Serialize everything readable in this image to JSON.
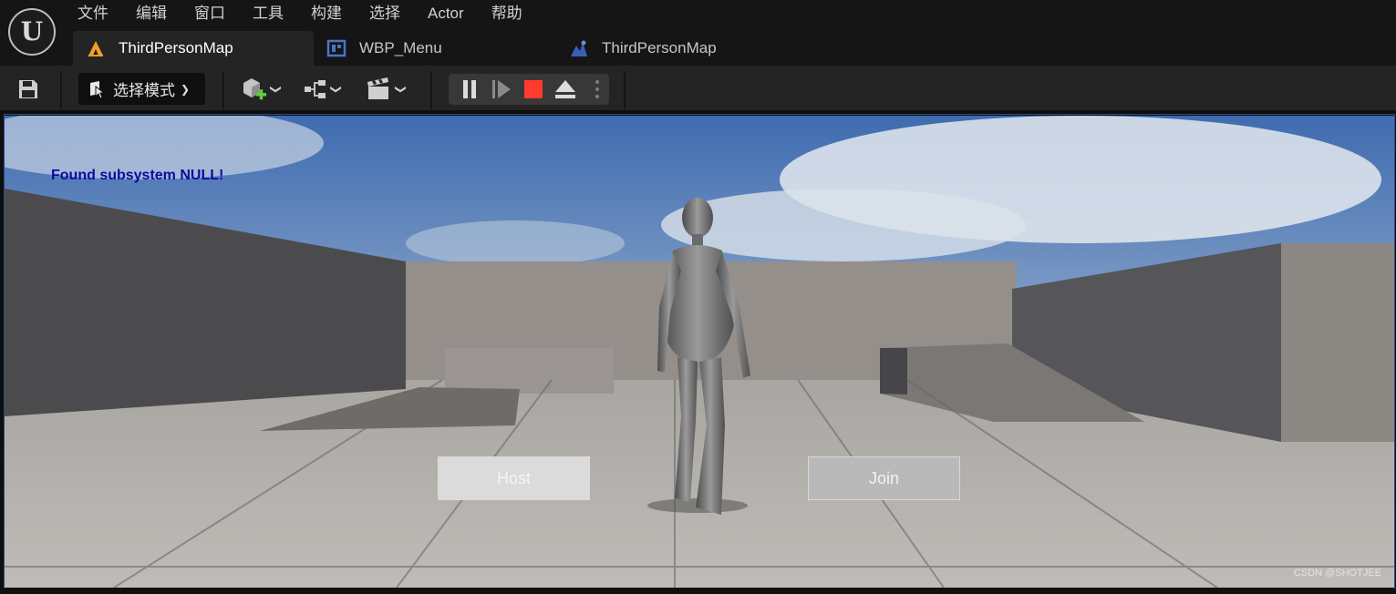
{
  "menubar": {
    "items": [
      "文件",
      "编辑",
      "窗口",
      "工具",
      "构建",
      "选择",
      "Actor",
      "帮助"
    ]
  },
  "tabs": [
    {
      "label": "ThirdPersonMap",
      "icon": "level-icon",
      "active": true
    },
    {
      "label": "WBP_Menu",
      "icon": "widget-blueprint-icon",
      "active": false
    },
    {
      "label": "ThirdPersonMap",
      "icon": "map-icon",
      "active": false
    }
  ],
  "toolbar": {
    "mode_label": "选择模式"
  },
  "viewport": {
    "debug_message": "Found subsystem NULL!",
    "host_label": "Host",
    "join_label": "Join"
  },
  "watermark": "CSDN @SHOTJEE",
  "colors": {
    "accent_orange": "#f0a020",
    "stop_red": "#ff3b30",
    "debug_text": "#0a0aa0",
    "viewport_border": "#2a4a8a"
  }
}
